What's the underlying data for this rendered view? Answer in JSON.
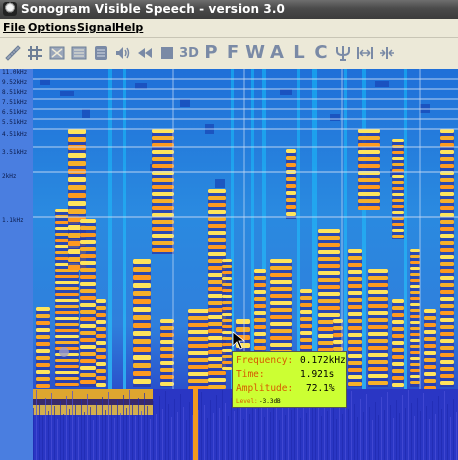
{
  "window": {
    "title": "Sonogram Visible Speech - version 3.0"
  },
  "menu": [
    {
      "label": "File"
    },
    {
      "label": "Options"
    },
    {
      "label": "Signal"
    },
    {
      "label": "Help"
    }
  ],
  "toolbar": {
    "letters": {
      "p1": "P",
      "f": "F",
      "w": "W",
      "a": "A",
      "l": "L",
      "c": "C"
    },
    "label_3d": "3D"
  },
  "axis": {
    "labels": [
      "11.0kHz",
      "9.52kHz",
      "8.51kHz",
      "7.51kHz",
      "6.51kHz",
      "5.51kHz",
      "4.51kHz",
      "3.51kHz",
      "2kHz",
      "1.1kHz"
    ]
  },
  "tooltip": {
    "frequency_label": "Frequency:",
    "frequency_value": "0.172kHz",
    "time_label": "Time:",
    "time_value": "1.921s",
    "amplitude_label": "Amplitude:",
    "amplitude_value": "72.1%",
    "level_label": "Level:",
    "level_value": "-3.3dB"
  },
  "colors": {
    "spectrogram_low": "#2a36c4",
    "spectrogram_mid": "#1fa0e8",
    "spectrogram_high": "#ffcc33",
    "tooltip_bg": "#ccff33"
  }
}
